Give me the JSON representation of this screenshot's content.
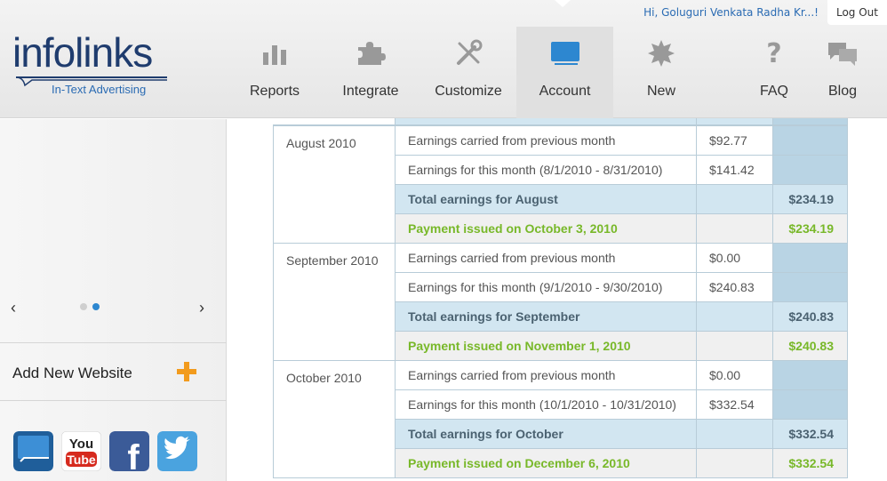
{
  "user": {
    "greeting": "Hi, Goluguri Venkata Radha Kr...!",
    "logout_label": "Log Out"
  },
  "brand": {
    "name": "infolinks",
    "tagline": "In-Text Advertising"
  },
  "nav": {
    "items": [
      {
        "label": "Reports",
        "icon": "bar-chart-icon"
      },
      {
        "label": "Integrate",
        "icon": "puzzle-icon"
      },
      {
        "label": "Customize",
        "icon": "tools-icon"
      },
      {
        "label": "Account",
        "icon": "account-card-icon",
        "active": true
      },
      {
        "label": "New",
        "icon": "star-burst-icon"
      },
      {
        "label": "FAQ",
        "icon": "question-icon"
      },
      {
        "label": "Blog",
        "icon": "chat-bubbles-icon"
      }
    ]
  },
  "sidebar": {
    "add_website_label": "Add New Website",
    "carousel_prev": "‹",
    "carousel_next": "›",
    "social": [
      "infolinks-icon",
      "youtube-icon",
      "facebook-icon",
      "twitter-icon"
    ],
    "youtube_word1": "You",
    "youtube_word2": "Tube",
    "facebook_letter": "f"
  },
  "colors": {
    "brand_blue": "#1f3c6e",
    "link_blue": "#2a6bb3",
    "accent_orange": "#f29b1d",
    "payment_green": "#78b829",
    "total_bg": "#d2e6f1"
  },
  "earnings": [
    {
      "month": "August 2010",
      "carried_label": "Earnings carried from previous month",
      "carried_amount": "$92.77",
      "this_label": "Earnings for this month (8/1/2010 - 8/31/2010)",
      "this_amount": "$141.42",
      "total_label": "Total earnings for August",
      "total_amount": "$234.19",
      "payment_label": "Payment issued on October 3, 2010",
      "payment_amount": "$234.19"
    },
    {
      "month": "September 2010",
      "carried_label": "Earnings carried from previous month",
      "carried_amount": "$0.00",
      "this_label": "Earnings for this month (9/1/2010 - 9/30/2010)",
      "this_amount": "$240.83",
      "total_label": "Total earnings for September",
      "total_amount": "$240.83",
      "payment_label": "Payment issued on November 1, 2010",
      "payment_amount": "$240.83"
    },
    {
      "month": "October 2010",
      "carried_label": "Earnings carried from previous month",
      "carried_amount": "$0.00",
      "this_label": "Earnings for this month (10/1/2010 - 10/31/2010)",
      "this_amount": "$332.54",
      "total_label": "Total earnings for October",
      "total_amount": "$332.54",
      "payment_label": "Payment issued on December 6, 2010",
      "payment_amount": "$332.54"
    }
  ]
}
